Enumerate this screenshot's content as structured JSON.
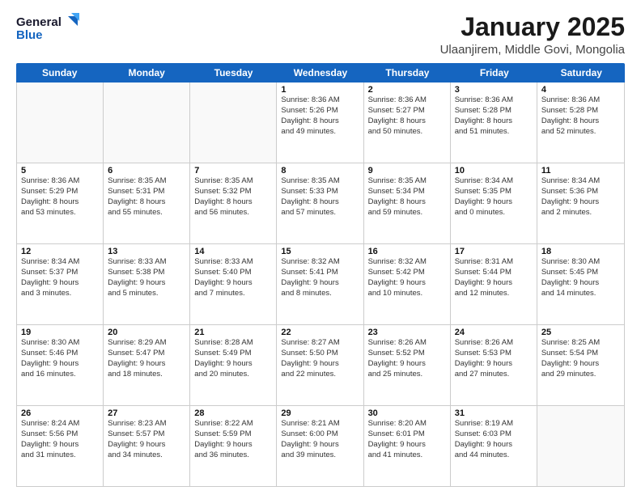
{
  "logo": {
    "line1": "General",
    "line2": "Blue"
  },
  "title": "January 2025",
  "subtitle": "Ulaanjirem, Middle Govi, Mongolia",
  "days_of_week": [
    "Sunday",
    "Monday",
    "Tuesday",
    "Wednesday",
    "Thursday",
    "Friday",
    "Saturday"
  ],
  "weeks": [
    [
      {
        "day": "",
        "info": "",
        "empty": true
      },
      {
        "day": "",
        "info": "",
        "empty": true
      },
      {
        "day": "",
        "info": "",
        "empty": true
      },
      {
        "day": "1",
        "info": "Sunrise: 8:36 AM\nSunset: 5:26 PM\nDaylight: 8 hours\nand 49 minutes."
      },
      {
        "day": "2",
        "info": "Sunrise: 8:36 AM\nSunset: 5:27 PM\nDaylight: 8 hours\nand 50 minutes."
      },
      {
        "day": "3",
        "info": "Sunrise: 8:36 AM\nSunset: 5:28 PM\nDaylight: 8 hours\nand 51 minutes."
      },
      {
        "day": "4",
        "info": "Sunrise: 8:36 AM\nSunset: 5:28 PM\nDaylight: 8 hours\nand 52 minutes."
      }
    ],
    [
      {
        "day": "5",
        "info": "Sunrise: 8:36 AM\nSunset: 5:29 PM\nDaylight: 8 hours\nand 53 minutes."
      },
      {
        "day": "6",
        "info": "Sunrise: 8:35 AM\nSunset: 5:31 PM\nDaylight: 8 hours\nand 55 minutes."
      },
      {
        "day": "7",
        "info": "Sunrise: 8:35 AM\nSunset: 5:32 PM\nDaylight: 8 hours\nand 56 minutes."
      },
      {
        "day": "8",
        "info": "Sunrise: 8:35 AM\nSunset: 5:33 PM\nDaylight: 8 hours\nand 57 minutes."
      },
      {
        "day": "9",
        "info": "Sunrise: 8:35 AM\nSunset: 5:34 PM\nDaylight: 8 hours\nand 59 minutes."
      },
      {
        "day": "10",
        "info": "Sunrise: 8:34 AM\nSunset: 5:35 PM\nDaylight: 9 hours\nand 0 minutes."
      },
      {
        "day": "11",
        "info": "Sunrise: 8:34 AM\nSunset: 5:36 PM\nDaylight: 9 hours\nand 2 minutes."
      }
    ],
    [
      {
        "day": "12",
        "info": "Sunrise: 8:34 AM\nSunset: 5:37 PM\nDaylight: 9 hours\nand 3 minutes."
      },
      {
        "day": "13",
        "info": "Sunrise: 8:33 AM\nSunset: 5:38 PM\nDaylight: 9 hours\nand 5 minutes."
      },
      {
        "day": "14",
        "info": "Sunrise: 8:33 AM\nSunset: 5:40 PM\nDaylight: 9 hours\nand 7 minutes."
      },
      {
        "day": "15",
        "info": "Sunrise: 8:32 AM\nSunset: 5:41 PM\nDaylight: 9 hours\nand 8 minutes."
      },
      {
        "day": "16",
        "info": "Sunrise: 8:32 AM\nSunset: 5:42 PM\nDaylight: 9 hours\nand 10 minutes."
      },
      {
        "day": "17",
        "info": "Sunrise: 8:31 AM\nSunset: 5:44 PM\nDaylight: 9 hours\nand 12 minutes."
      },
      {
        "day": "18",
        "info": "Sunrise: 8:30 AM\nSunset: 5:45 PM\nDaylight: 9 hours\nand 14 minutes."
      }
    ],
    [
      {
        "day": "19",
        "info": "Sunrise: 8:30 AM\nSunset: 5:46 PM\nDaylight: 9 hours\nand 16 minutes."
      },
      {
        "day": "20",
        "info": "Sunrise: 8:29 AM\nSunset: 5:47 PM\nDaylight: 9 hours\nand 18 minutes."
      },
      {
        "day": "21",
        "info": "Sunrise: 8:28 AM\nSunset: 5:49 PM\nDaylight: 9 hours\nand 20 minutes."
      },
      {
        "day": "22",
        "info": "Sunrise: 8:27 AM\nSunset: 5:50 PM\nDaylight: 9 hours\nand 22 minutes."
      },
      {
        "day": "23",
        "info": "Sunrise: 8:26 AM\nSunset: 5:52 PM\nDaylight: 9 hours\nand 25 minutes."
      },
      {
        "day": "24",
        "info": "Sunrise: 8:26 AM\nSunset: 5:53 PM\nDaylight: 9 hours\nand 27 minutes."
      },
      {
        "day": "25",
        "info": "Sunrise: 8:25 AM\nSunset: 5:54 PM\nDaylight: 9 hours\nand 29 minutes."
      }
    ],
    [
      {
        "day": "26",
        "info": "Sunrise: 8:24 AM\nSunset: 5:56 PM\nDaylight: 9 hours\nand 31 minutes."
      },
      {
        "day": "27",
        "info": "Sunrise: 8:23 AM\nSunset: 5:57 PM\nDaylight: 9 hours\nand 34 minutes."
      },
      {
        "day": "28",
        "info": "Sunrise: 8:22 AM\nSunset: 5:59 PM\nDaylight: 9 hours\nand 36 minutes."
      },
      {
        "day": "29",
        "info": "Sunrise: 8:21 AM\nSunset: 6:00 PM\nDaylight: 9 hours\nand 39 minutes."
      },
      {
        "day": "30",
        "info": "Sunrise: 8:20 AM\nSunset: 6:01 PM\nDaylight: 9 hours\nand 41 minutes."
      },
      {
        "day": "31",
        "info": "Sunrise: 8:19 AM\nSunset: 6:03 PM\nDaylight: 9 hours\nand 44 minutes."
      },
      {
        "day": "",
        "info": "",
        "empty": true
      }
    ]
  ]
}
